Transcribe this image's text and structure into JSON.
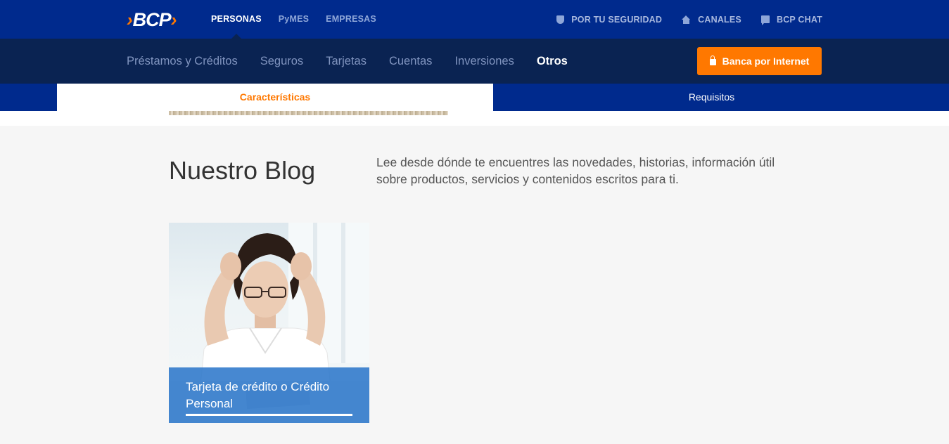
{
  "brand": {
    "logo_text": "BCP"
  },
  "top_segments": [
    {
      "label": "PERSONAS",
      "active": true
    },
    {
      "label": "PyMES",
      "active": false
    },
    {
      "label": "EMPRESAS",
      "active": false
    }
  ],
  "utilities": {
    "security": "POR TU SEGURIDAD",
    "channels": "CANALES",
    "chat": "BCP CHAT"
  },
  "main_nav": [
    {
      "label": "Préstamos y Créditos",
      "active": false
    },
    {
      "label": "Seguros",
      "active": false
    },
    {
      "label": "Tarjetas",
      "active": false
    },
    {
      "label": "Cuentas",
      "active": false
    },
    {
      "label": "Inversiones",
      "active": false
    },
    {
      "label": "Otros",
      "active": true
    }
  ],
  "banca_button": "Banca por Internet",
  "tabs": [
    {
      "label": "Características",
      "active": true
    },
    {
      "label": "Requisitos",
      "active": false
    }
  ],
  "blog": {
    "title": "Nuestro Blog",
    "description": "Lee desde dónde te encuentres las novedades, historias, información útil sobre productos, servicios y contenidos escritos para ti.",
    "cards": [
      {
        "title": "Tarjeta de crédito o Crédito Personal"
      }
    ]
  },
  "colors": {
    "brand_blue": "#002a8d",
    "nav_dark": "#0a2352",
    "accent_orange": "#ff7800",
    "card_overlay": "#2975c9"
  }
}
